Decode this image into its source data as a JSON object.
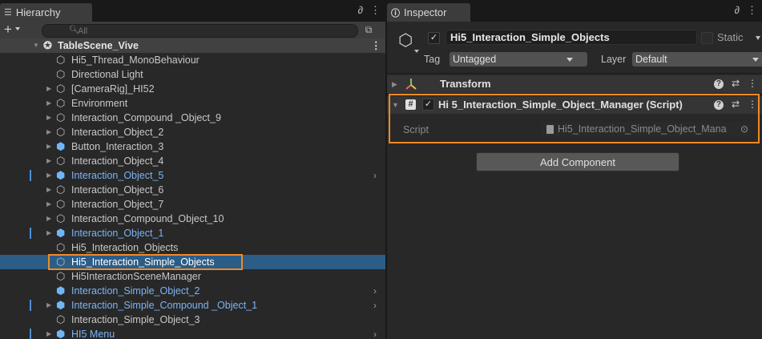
{
  "hierarchy": {
    "tab_label": "Hierarchy",
    "search_placeholder": "All",
    "scene": "TableScene_Vive",
    "items": [
      {
        "label": "Hi5_Thread_MonoBehaviour",
        "icon": "gameobject-icon",
        "fold": false,
        "blue": false,
        "mark": false,
        "chevron": false,
        "selected": false
      },
      {
        "label": "Directional Light",
        "icon": "gameobject-icon",
        "fold": false,
        "blue": false,
        "mark": false,
        "chevron": false,
        "selected": false
      },
      {
        "label": "[CameraRig]_HI52",
        "icon": "gameobject-icon",
        "fold": true,
        "blue": false,
        "mark": false,
        "chevron": false,
        "selected": false
      },
      {
        "label": "Environment",
        "icon": "gameobject-icon",
        "fold": true,
        "blue": false,
        "mark": false,
        "chevron": false,
        "selected": false
      },
      {
        "label": "Interaction_Compound _Object_9",
        "icon": "gameobject-icon",
        "fold": true,
        "blue": false,
        "mark": false,
        "chevron": false,
        "selected": false
      },
      {
        "label": "Interaction_Object_2",
        "icon": "gameobject-icon",
        "fold": true,
        "blue": false,
        "mark": false,
        "chevron": false,
        "selected": false
      },
      {
        "label": "Button_Interaction_3",
        "icon": "prefab-icon",
        "fold": true,
        "blue": false,
        "mark": false,
        "chevron": false,
        "selected": false
      },
      {
        "label": "Interaction_Object_4",
        "icon": "gameobject-icon",
        "fold": true,
        "blue": false,
        "mark": false,
        "chevron": false,
        "selected": false
      },
      {
        "label": "Interaction_Object_5",
        "icon": "prefab-icon",
        "fold": true,
        "blue": true,
        "mark": true,
        "chevron": true,
        "selected": false
      },
      {
        "label": "Interaction_Object_6",
        "icon": "gameobject-icon",
        "fold": true,
        "blue": false,
        "mark": false,
        "chevron": false,
        "selected": false
      },
      {
        "label": "Interaction_Object_7",
        "icon": "gameobject-icon",
        "fold": true,
        "blue": false,
        "mark": false,
        "chevron": false,
        "selected": false
      },
      {
        "label": "Interaction_Compound_Object_10",
        "icon": "gameobject-icon",
        "fold": true,
        "blue": false,
        "mark": false,
        "chevron": false,
        "selected": false
      },
      {
        "label": "Interaction_Object_1",
        "icon": "prefab-icon",
        "fold": true,
        "blue": true,
        "mark": true,
        "chevron": false,
        "selected": false
      },
      {
        "label": "Hi5_Interaction_Objects",
        "icon": "gameobject-icon",
        "fold": false,
        "blue": false,
        "mark": false,
        "chevron": false,
        "selected": false
      },
      {
        "label": "Hi5_Interaction_Simple_Objects",
        "icon": "gameobject-icon",
        "fold": false,
        "blue": false,
        "mark": false,
        "chevron": false,
        "selected": true
      },
      {
        "label": "Hi5InteractionSceneManager",
        "icon": "gameobject-icon",
        "fold": false,
        "blue": false,
        "mark": false,
        "chevron": false,
        "selected": false
      },
      {
        "label": "Interaction_Simple_Object_2",
        "icon": "prefab-icon",
        "fold": false,
        "blue": true,
        "mark": false,
        "chevron": true,
        "selected": false
      },
      {
        "label": "Interaction_Simple_Compound _Object_1",
        "icon": "prefab-icon",
        "fold": true,
        "blue": true,
        "mark": true,
        "chevron": true,
        "selected": false
      },
      {
        "label": "Interaction_Simple_Object_3",
        "icon": "gameobject-icon",
        "fold": false,
        "blue": false,
        "mark": false,
        "chevron": false,
        "selected": false
      },
      {
        "label": "HI5 Menu",
        "icon": "prefab-icon",
        "fold": true,
        "blue": true,
        "mark": true,
        "chevron": true,
        "selected": false
      }
    ]
  },
  "inspector": {
    "tab_label": "Inspector",
    "object_name": "Hi5_Interaction_Simple_Objects",
    "static_label": "Static",
    "tag_label": "Tag",
    "tag_value": "Untagged",
    "layer_label": "Layer",
    "layer_value": "Default",
    "transform_title": "Transform",
    "component_title": "Hi 5_Interaction_Simple_Object_Manager (Script)",
    "script_label": "Script",
    "script_value": "Hi5_Interaction_Simple_Object_Mana",
    "add_component": "Add Component"
  },
  "colors": {
    "selection": "#2c5d87",
    "highlight_outline": "#f08a24",
    "prefab_blue": "#7ab4f5"
  }
}
